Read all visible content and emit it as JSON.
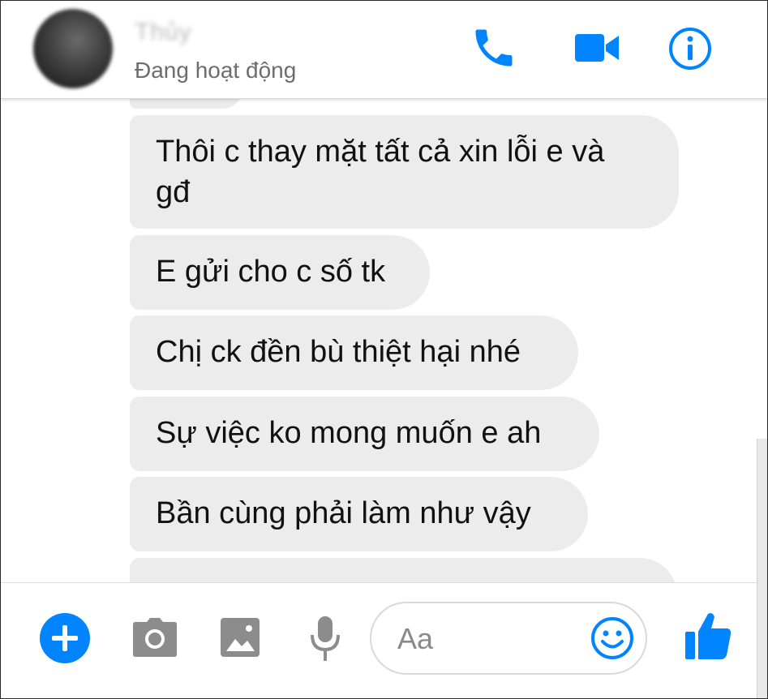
{
  "header": {
    "contact_name": "Thủy",
    "status": "Đang hoạt động",
    "icons": [
      "phone-icon",
      "video-icon",
      "info-icon"
    ]
  },
  "messages": [
    {
      "line1": "Thôi c thay mặt tất cả xin lỗi e và",
      "line2": "gđ"
    },
    {
      "text": "E gửi cho c số tk"
    },
    {
      "text": "Chị ck đền bù thiệt hại nhé"
    },
    {
      "text": "Sự việc ko mong muốn e ah"
    },
    {
      "text": "Bần cùng phải làm như vậy"
    }
  ],
  "composer": {
    "placeholder": "Aa",
    "icons": [
      "plus-icon",
      "camera-icon",
      "image-icon",
      "microphone-icon",
      "emoji-icon",
      "like-icon"
    ]
  },
  "colors": {
    "accent": "#0084ff",
    "bubble": "#ececec",
    "icon_gray": "#8c8c8c"
  }
}
